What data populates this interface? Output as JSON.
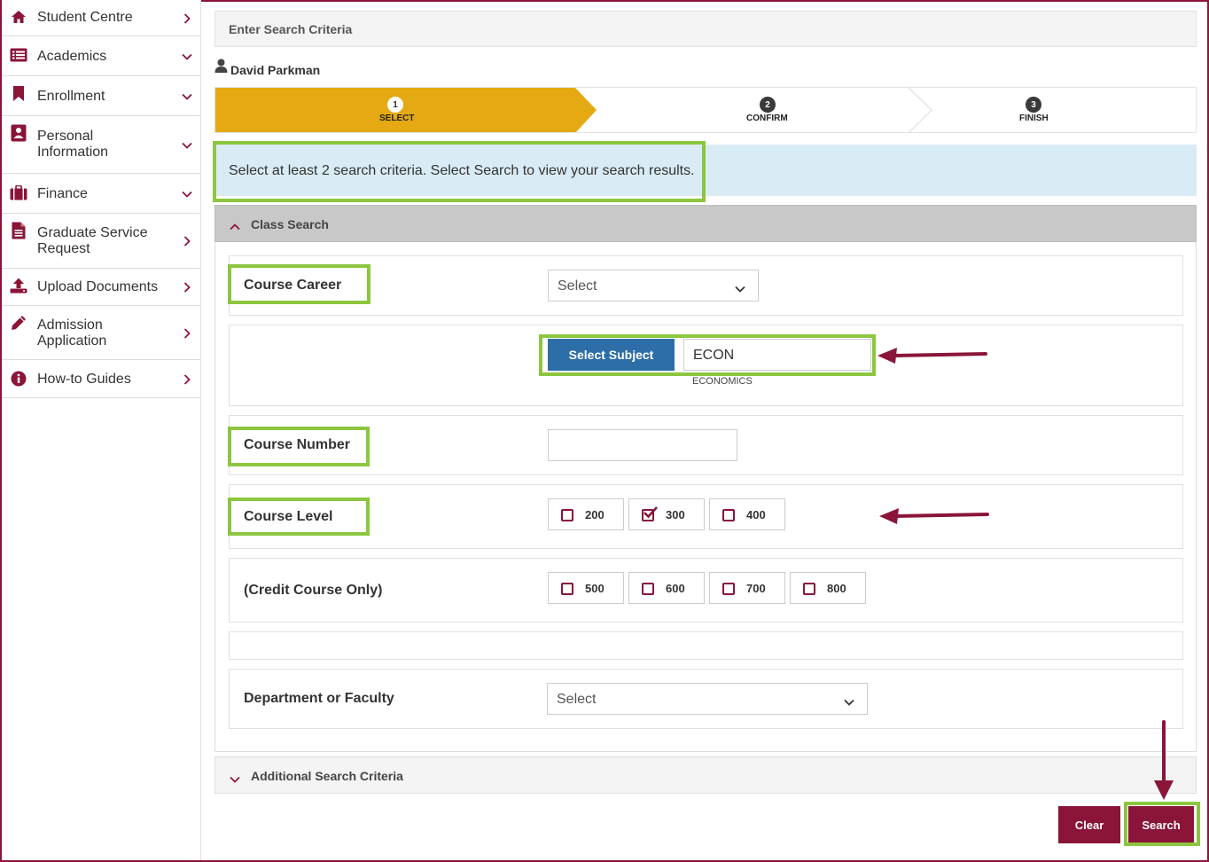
{
  "sidebar": {
    "items": [
      {
        "label": "Student Centre",
        "icon": "home-icon",
        "chevron": "right"
      },
      {
        "label": "Academics",
        "icon": "list-icon",
        "chevron": "down"
      },
      {
        "label": "Enrollment",
        "icon": "bookmark-icon",
        "chevron": "down"
      },
      {
        "label": "Personal Information",
        "icon": "contact-card-icon",
        "chevron": "down"
      },
      {
        "label": "Finance",
        "icon": "briefcase-icon",
        "chevron": "down"
      },
      {
        "label": "Graduate Service Request",
        "icon": "document-icon",
        "chevron": "right"
      },
      {
        "label": "Upload Documents",
        "icon": "upload-icon",
        "chevron": "right"
      },
      {
        "label": "Admission Application",
        "icon": "pencil-icon",
        "chevron": "right"
      },
      {
        "label": "How-to Guides",
        "icon": "info-icon",
        "chevron": "right"
      }
    ]
  },
  "header": {
    "title": "Enter Search Criteria"
  },
  "user": {
    "name": "David Parkman"
  },
  "stepper": {
    "steps": [
      {
        "number": "1",
        "label": "SELECT",
        "active": true
      },
      {
        "number": "2",
        "label": "CONFIRM",
        "active": false
      },
      {
        "number": "3",
        "label": "FINISH",
        "active": false
      }
    ]
  },
  "info": {
    "message": "Select at least 2 search criteria. Select Search to view your search results."
  },
  "class_search": {
    "title": "Class Search",
    "course_career": {
      "label": "Course Career",
      "value": "Select"
    },
    "subject": {
      "button_label": "Select Subject",
      "value": "ECON",
      "description": "ECONOMICS"
    },
    "course_number": {
      "label": "Course Number",
      "value": ""
    },
    "course_level": {
      "label": "Course Level",
      "options": [
        {
          "label": "200",
          "checked": false
        },
        {
          "label": "300",
          "checked": true
        },
        {
          "label": "400",
          "checked": false
        }
      ]
    },
    "credit_course": {
      "label": "(Credit Course Only)",
      "options": [
        {
          "label": "500",
          "checked": false
        },
        {
          "label": "600",
          "checked": false
        },
        {
          "label": "700",
          "checked": false
        },
        {
          "label": "800",
          "checked": false
        }
      ]
    },
    "department": {
      "label": "Department or Faculty",
      "value": "Select"
    }
  },
  "additional": {
    "title": "Additional Search Criteria"
  },
  "actions": {
    "clear_label": "Clear",
    "search_label": "Search"
  },
  "colors": {
    "brand": "#8a1538",
    "active_step": "#e5a913",
    "highlight": "#8cc63f",
    "subject_button": "#2e6ea8",
    "info_bg": "#d9ecf5"
  }
}
